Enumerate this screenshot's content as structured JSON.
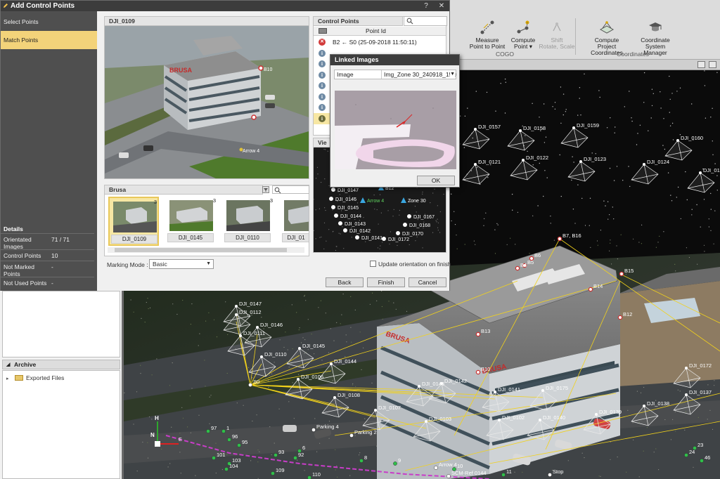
{
  "dialog": {
    "title": "Add Control Points",
    "steps": [
      {
        "label": "Select Points",
        "active": false
      },
      {
        "label": "Match Points",
        "active": true
      }
    ],
    "details": {
      "title": "Details",
      "rows": [
        {
          "key": "Orientated Images",
          "value": "71 / 71"
        },
        {
          "key": "Control Points",
          "value": "10"
        },
        {
          "key": "Not Marked Points",
          "value": "-"
        },
        {
          "key": "Not Used Points",
          "value": "-"
        }
      ]
    },
    "photo_title": "DJI_0109",
    "photo_labels": {
      "brusa": "BRUSA",
      "b10": "B10",
      "arrow4": "Arrow 4"
    },
    "gallery": {
      "title": "Brusa",
      "thumbs": [
        {
          "label": "DJI_0109",
          "count": "3",
          "selected": true
        },
        {
          "label": "DJI_0145",
          "count": "3",
          "selected": false
        },
        {
          "label": "DJI_0110",
          "count": "3",
          "selected": false
        },
        {
          "label": "DJI_01",
          "count": "",
          "selected": false
        }
      ]
    },
    "marking_mode": {
      "label": "Marking Mode :",
      "value": "Basic"
    },
    "update_orientation": {
      "label": "Update orientation on finish",
      "checked": false
    },
    "buttons": {
      "back": "Back",
      "finish": "Finish",
      "cancel": "Cancel"
    },
    "control_points": {
      "title": "Control Points",
      "column": "Point Id",
      "rows": [
        {
          "status": "error",
          "text": "B2 ← S0 (25-09-2018 11:50:11)"
        },
        {
          "status": "info",
          "text": ""
        },
        {
          "status": "info",
          "text": ""
        },
        {
          "status": "info",
          "text": ""
        },
        {
          "status": "info",
          "text": ""
        },
        {
          "status": "info",
          "text": ""
        },
        {
          "status": "info",
          "text": ""
        },
        {
          "status": "info",
          "text": ""
        }
      ]
    },
    "view_panel": {
      "title": "Vie",
      "labels": [
        "DJI_0147",
        "DJI_0146",
        "DJI_0145",
        "DJI_0144",
        "DJI_0143",
        "DJI_0142",
        "DJI_0141",
        "DJI_0172",
        "DJI_0170",
        "DJI_0168",
        "DJI_0167",
        "Arrow 4",
        "B12",
        "Zone 30"
      ]
    }
  },
  "linked_images": {
    "title": "Linked Images",
    "image_label": "Image",
    "image_value": "Img_Zone 30_240918_151007",
    "ok": "OK"
  },
  "ribbon": {
    "buttons": [
      {
        "label": "Measure\nPoint to Point",
        "disabled": false
      },
      {
        "label": "Compute\nPoint ▾",
        "disabled": false
      },
      {
        "label": "Shift\nRotate, Scale",
        "disabled": true
      },
      {
        "label": "Compute\nProject Coordinates",
        "disabled": false
      },
      {
        "label": "Coordinate\nSystem Manager",
        "disabled": false
      }
    ],
    "groups": [
      "COGO",
      "Coordinates"
    ]
  },
  "archive": {
    "title": "Archive",
    "items": [
      "Exported Files"
    ]
  },
  "scene_labels": {
    "cameras": [
      "DJI_0157",
      "DJI_0158",
      "DJI_0159",
      "DJI_0160",
      "DJI_0121",
      "DJI_0122",
      "DJI_0123",
      "DJI_0124",
      "DJI_0125",
      "DJI_0147",
      "DJI_0146",
      "DJI_0112",
      "DJI_0111",
      "DJI_0110",
      "DJI_0145",
      "DJI_0144",
      "DJI_0106",
      "DJI_0108",
      "DJI_0107",
      "DJI_0143",
      "DJI_0142",
      "DJI_0141",
      "DJI_0175",
      "DJI_0103",
      "DJI_0102",
      "DJI_0140",
      "DJI_0139",
      "DJI_0138",
      "DJI_0137",
      "DJI_0172"
    ],
    "points": [
      "B7, B16",
      "B6",
      "B5",
      "B4",
      "B15",
      "B14",
      "B13",
      "B12",
      "B10",
      "S0",
      "Parking 4",
      "Parking 2",
      "Arrow 4",
      "SCM-Ref 0144",
      "Stop",
      "97",
      "96",
      "95",
      "93",
      "92",
      "101",
      "103",
      "104",
      "109",
      "110",
      "1",
      "6",
      "8",
      "9",
      "10",
      "11",
      "23",
      "24",
      "46"
    ],
    "brusa": "BRUSA"
  },
  "colors": {
    "accent": "#f3d37a",
    "link_lines": "#f2d21b",
    "purple_path": "#c83dc8"
  }
}
